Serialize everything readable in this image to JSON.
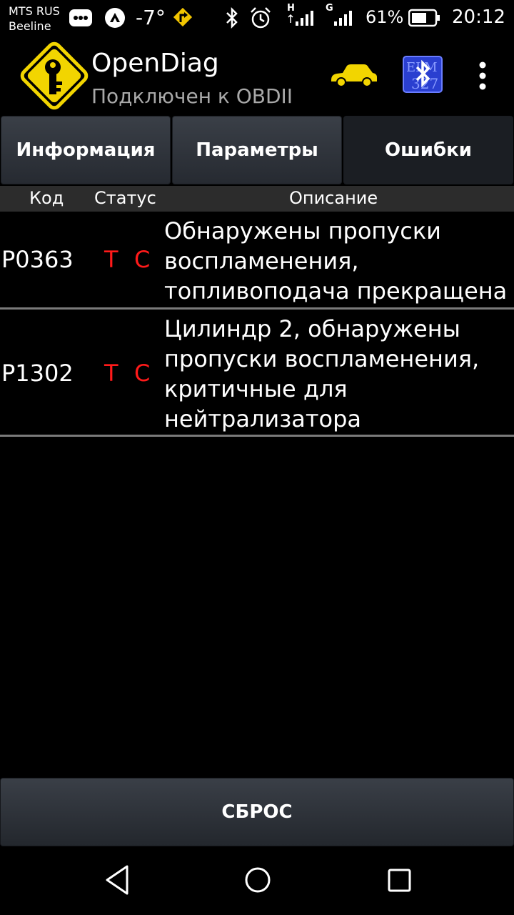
{
  "status_bar": {
    "carrier_line1": "MTS RUS",
    "carrier_line2": "Beeline",
    "temperature": "-7°",
    "battery_percent": "61%",
    "time": "20:12",
    "net1": "H",
    "net2": "G",
    "icons": [
      "messages-icon",
      "app-icon",
      "navigation-icon",
      "bluetooth-icon",
      "alarm-icon",
      "signal-icon",
      "battery-icon"
    ]
  },
  "app_bar": {
    "title": "OpenDiag",
    "subtitle": "Подключен к OBDII",
    "logo": "key-diamond-logo",
    "car_color": "#f2d500"
  },
  "tabs": [
    {
      "label": "Информация",
      "active": false
    },
    {
      "label": "Параметры",
      "active": false
    },
    {
      "label": "Ошибки",
      "active": true
    }
  ],
  "table": {
    "headers": {
      "code": "Код",
      "status": "Статус",
      "description": "Описание"
    },
    "rows": [
      {
        "code": "P0363",
        "status_t": "T",
        "status_c": "C",
        "description": "Обнаружены пропуски\nвоспламенения,\nтопливоподача прекращена"
      },
      {
        "code": "P1302",
        "status_t": "T",
        "status_c": "C",
        "description": "Цилиндр 2, обнаружены\nпропуски воспламенения,\nкритичные для\nнейтрализатора"
      }
    ]
  },
  "reset_button": {
    "label": "СБРОС"
  },
  "colors": {
    "status_red": "#ff1a1a",
    "accent_yellow": "#f2d500",
    "bt_blue": "#2a3fd0"
  }
}
